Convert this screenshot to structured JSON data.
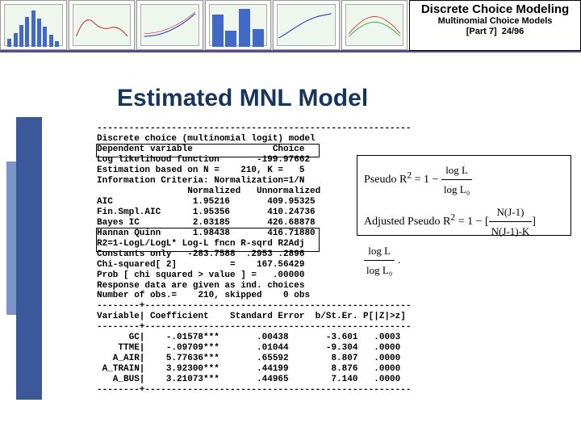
{
  "header": {
    "title": "Discrete Choice Modeling",
    "subtitle": "Multinomial Choice Models",
    "part": "[Part 7]",
    "page": "24/96"
  },
  "slide_title": "Estimated MNL Model",
  "output": {
    "hr1": "-----------------------------------------------------------",
    "l1": "Discrete choice (multinomial logit) model",
    "l2": "Dependent variable               Choice",
    "l3": "Log likelihood function       -199.97662",
    "l4": "Estimation based on N =    210, K =   5",
    "l5": "Information Criteria: Normalization=1/N",
    "l6": "                 Normalized   Unnormalized",
    "l7": "AIC               1.95216       409.95325",
    "l8": "Fin.Smpl.AIC      1.95356       410.24736",
    "l9": "Bayes IC          2.03185       426.68878",
    "l10": "Hannan Quinn      1.98438       416.71880",
    "l11": "R2=1-LogL/LogL* Log-L fncn R-sqrd R2Adj",
    "l12": "Constants only   -283.7588  .2953 .2896",
    "l13": "Chi-squared[ 2]          =    167.56429",
    "l14": "Prob [ chi squared > value ] =   .00000",
    "l15": "Response data are given as ind. choices",
    "l16": "Number of obs.=    210, skipped    0 obs",
    "hr2": "--------+--------------------------------------------------",
    "l17": "Variable| Coefficient    Standard Error  b/St.Er. P[|Z|>z]",
    "hr3": "--------+--------------------------------------------------",
    "l18": "      GC|    -.01578***       .00438       -3.601   .0003",
    "l19": "    TTME|    -.09709***       .01044       -9.304   .0000",
    "l20": "   A_AIR|    5.77636***       .65592        8.807   .0000",
    "l21": " A_TRAIN|    3.92300***       .44199        8.876   .0000",
    "l22": "   A_BUS|    3.21073***       .44965        7.140   .0000",
    "hr4": "--------+--------------------------------------------------"
  },
  "formulas": {
    "f1_lhs": "Pseudo R",
    "f1_sup": "2",
    "f1_eq": " = 1 − ",
    "f1_num": "log L",
    "f1_den": "log L₀",
    "f2_lhs": "Adjusted Pseudo R",
    "f2_eq": " = 1 − ",
    "f2_num_a": "N(J-1)",
    "f2_num_b": "N(J-1)-K",
    "f2_tail_num": "log L",
    "f2_tail_den": "log L₀"
  }
}
